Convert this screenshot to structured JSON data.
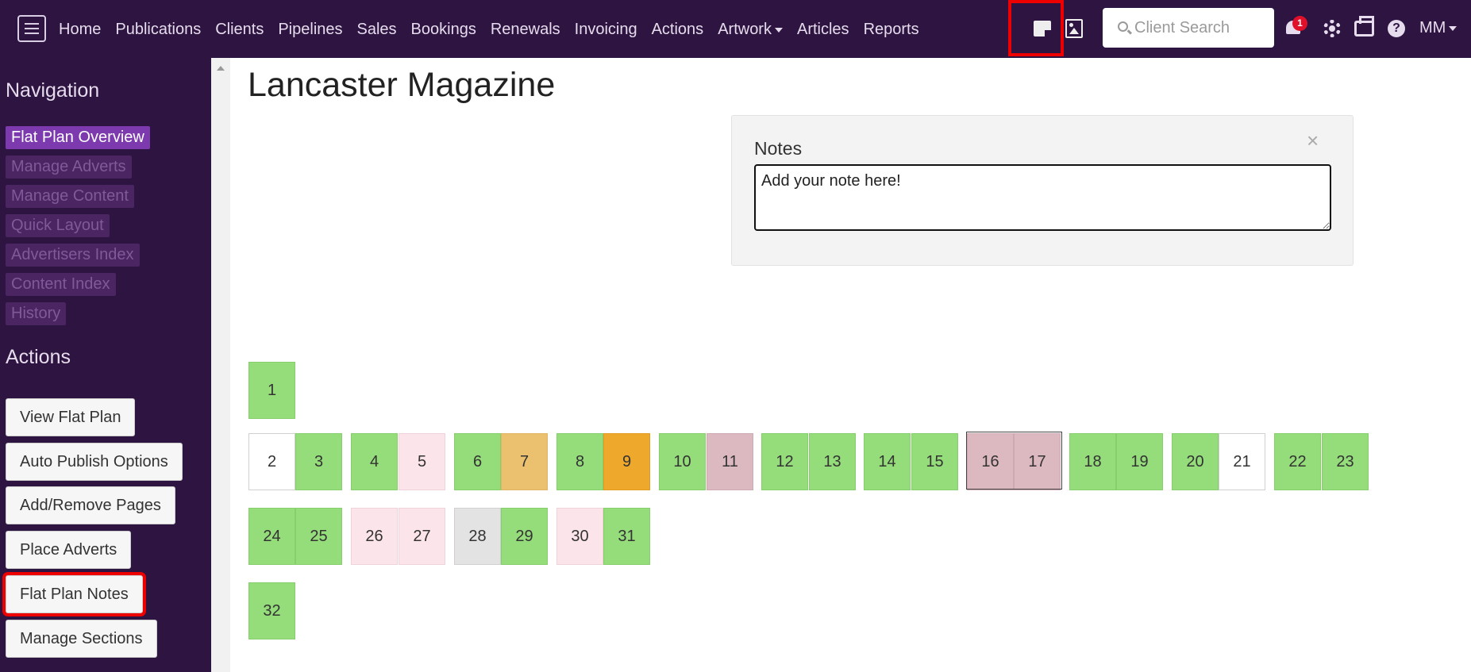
{
  "topbar": {
    "nav": [
      "Home",
      "Publications",
      "Clients",
      "Pipelines",
      "Sales",
      "Bookings",
      "Renewals",
      "Invoicing",
      "Actions",
      "Artwork",
      "Articles",
      "Reports"
    ],
    "search_placeholder": "Client Search",
    "notification_count": "1",
    "user": "MM"
  },
  "sidebar": {
    "navigation_heading": "Navigation",
    "links": [
      "Flat Plan Overview",
      "Manage Adverts",
      "Manage Content",
      "Quick Layout",
      "Advertisers Index",
      "Content Index",
      "History"
    ],
    "actions_heading": "Actions",
    "buttons": [
      "View Flat Plan",
      "Auto Publish Options",
      "Add/Remove Pages",
      "Place Adverts",
      "Flat Plan Notes",
      "Manage Sections"
    ]
  },
  "main": {
    "title": "Lancaster Magazine",
    "notes": {
      "label": "Notes",
      "close": "×",
      "text": "Add your note here!"
    },
    "pages": [
      {
        "n": "1",
        "status": "green"
      },
      {
        "n": "2",
        "status": "white"
      },
      {
        "n": "3",
        "status": "green"
      },
      {
        "n": "4",
        "status": "green"
      },
      {
        "n": "5",
        "status": "pink"
      },
      {
        "n": "6",
        "status": "green"
      },
      {
        "n": "7",
        "status": "peach"
      },
      {
        "n": "8",
        "status": "green"
      },
      {
        "n": "9",
        "status": "orange"
      },
      {
        "n": "10",
        "status": "green"
      },
      {
        "n": "11",
        "status": "mauve"
      },
      {
        "n": "12",
        "status": "green"
      },
      {
        "n": "13",
        "status": "green"
      },
      {
        "n": "14",
        "status": "green"
      },
      {
        "n": "15",
        "status": "green"
      },
      {
        "n": "16",
        "status": "mauve"
      },
      {
        "n": "17",
        "status": "mauve"
      },
      {
        "n": "18",
        "status": "green"
      },
      {
        "n": "19",
        "status": "green"
      },
      {
        "n": "20",
        "status": "green"
      },
      {
        "n": "21",
        "status": "white"
      },
      {
        "n": "22",
        "status": "green"
      },
      {
        "n": "23",
        "status": "green"
      },
      {
        "n": "24",
        "status": "green"
      },
      {
        "n": "25",
        "status": "green"
      },
      {
        "n": "26",
        "status": "pink"
      },
      {
        "n": "27",
        "status": "pink"
      },
      {
        "n": "28",
        "status": "gray"
      },
      {
        "n": "29",
        "status": "green"
      },
      {
        "n": "30",
        "status": "pink"
      },
      {
        "n": "31",
        "status": "green"
      },
      {
        "n": "32",
        "status": "green"
      }
    ]
  },
  "colors": {
    "topbar": "#2e1440",
    "active_link": "#7c3aae",
    "highlight_red": "#ee0000",
    "page_green": "#95dd7b",
    "page_orange": "#eea92d"
  }
}
